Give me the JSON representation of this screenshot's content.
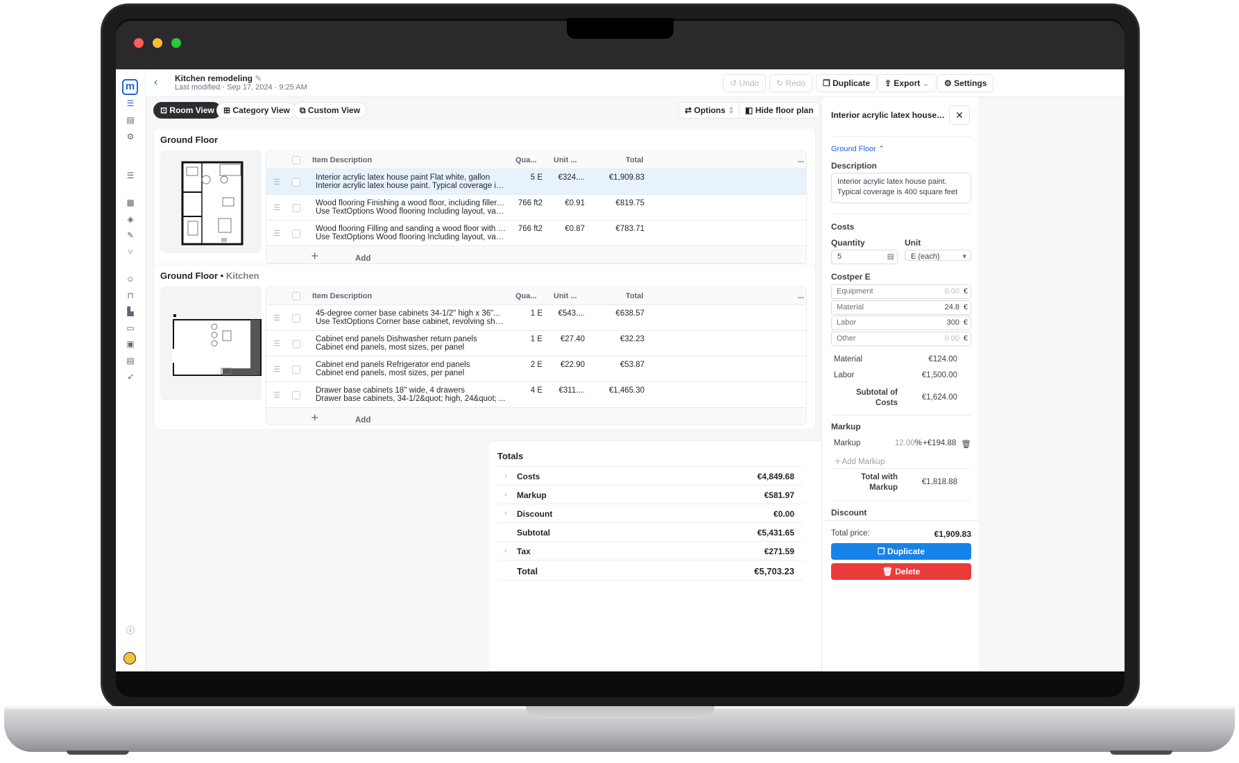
{
  "app": {
    "doc_title": "Kitchen remodeling",
    "doc_meta": "Last modified · Sep 17, 2024 · 9:25 AM",
    "logo_letter": "m"
  },
  "toolbar": {
    "undo": "Undo",
    "redo": "Redo",
    "duplicate": "Duplicate",
    "export": "Export",
    "settings": "Settings"
  },
  "views": {
    "room": "Room View",
    "category": "Category View",
    "custom": "Custom View",
    "options": "Options",
    "hide_floor_plan": "Hide floor plan"
  },
  "columns": {
    "description": "Item Description",
    "quantity": "Qua...",
    "unit": "Unit ...",
    "total": "Total",
    "more": "..."
  },
  "sections": [
    {
      "title": "Ground Floor",
      "subtitle": "",
      "add_label": "Add",
      "rows": [
        {
          "line1": "Interior acrylic latex house paint Flat white, gallon",
          "line2": "Interior acrylic latex house paint. Typical coverage is ...",
          "qty": "5 E",
          "unit": "€324....",
          "total": "€1,909.83",
          "selected": true
        },
        {
          "line1": "Wood flooring Finishing a wood floor, including filler, ...",
          "line2": "Use TextOptions Wood flooring Including layout, vap...",
          "qty": "766 ft2",
          "unit": "€0.91",
          "total": "€819.75",
          "selected": false
        },
        {
          "line1": "Wood flooring Filling and sanding a wood floor with d...",
          "line2": "Use TextOptions Wood flooring Including layout, vap...",
          "qty": "766 ft2",
          "unit": "€0.87",
          "total": "€783.71",
          "selected": false
        }
      ]
    },
    {
      "title": "Ground Floor •",
      "subtitle": "Kitchen",
      "add_label": "Add",
      "rows": [
        {
          "line1": "45-degree corner base cabinets 34-1/2\" high x 36\"...",
          "line2": "Use TextOptions Corner base cabinet, revolving shel...",
          "qty": "1 E",
          "unit": "€543....",
          "total": "€638.57",
          "selected": false
        },
        {
          "line1": "Cabinet end panels Dishwasher return panels",
          "line2": "Cabinet end panels, most sizes, per panel",
          "qty": "1 E",
          "unit": "€27.40",
          "total": "€32.23",
          "selected": false
        },
        {
          "line1": "Cabinet end panels Refrigerator end panels",
          "line2": "Cabinet end panels, most sizes, per panel",
          "qty": "2 E",
          "unit": "€22.90",
          "total": "€53.87",
          "selected": false
        },
        {
          "line1": "Drawer base cabinets 18\" wide, 4 drawers",
          "line2": "Drawer base cabinets, 34-1/2&quot; high, 24&quot; ...",
          "qty": "4 E",
          "unit": "€311....",
          "total": "€1,465.30",
          "selected": false
        }
      ]
    }
  ],
  "totals": {
    "title": "Totals",
    "rows": [
      {
        "label": "Costs",
        "value": "€4,849.68"
      },
      {
        "label": "Markup",
        "value": "€581.97"
      },
      {
        "label": "Discount",
        "value": "€0.00"
      },
      {
        "label": "Subtotal",
        "value": "€5,431.65"
      },
      {
        "label": "Tax",
        "value": "€271.59"
      },
      {
        "label": "Total",
        "value": "€5,703.23"
      }
    ]
  },
  "panel": {
    "title": "Interior acrylic latex house pa...",
    "breadcrumb": "Ground Floor",
    "description_label": "Description",
    "description": "Interior acrylic latex house paint. Typical coverage is 400 square feet",
    "costs_label": "Costs",
    "quantity_label": "Quantity",
    "quantity": "5",
    "unit_label": "Unit",
    "unit": "E (each)",
    "costper_label": "Costper E",
    "cost_inputs": [
      {
        "label": "Equipment",
        "value": "0.00",
        "currency": "€",
        "placeholder": true
      },
      {
        "label": "Material",
        "value": "24.8",
        "currency": "€",
        "placeholder": false
      },
      {
        "label": "Labor",
        "value": "300",
        "currency": "€",
        "placeholder": false
      },
      {
        "label": "Other",
        "value": "0.00",
        "currency": "€",
        "placeholder": true
      }
    ],
    "material_label": "Material",
    "material_total": "€124.00",
    "labor_label": "Labor",
    "labor_total": "€1,500.00",
    "subtotal_label_1": "Subtotal of",
    "subtotal_label_2": "Costs",
    "subtotal": "€1,624.00",
    "markup_section": "Markup",
    "markup_label": "Markup",
    "markup_pct": "12.00",
    "markup_amount": "+€194.88",
    "add_markup": "Add Markup",
    "total_markup_label_1": "Total with",
    "total_markup_label_2": "Markup",
    "total_with_markup": "€1,818.88",
    "discount_label": "Discount",
    "total_price_label": "Total price:",
    "total_price": "€1,909.83",
    "duplicate": "Duplicate",
    "delete": "Delete"
  },
  "colors": {
    "accent": "#1e63d6",
    "selected_row": "#e8f2fd",
    "duplicate_button": "#1683e8",
    "delete_button": "#ec3b3b",
    "traffic_red": "#fe5f57",
    "traffic_yellow": "#febc2e",
    "traffic_green": "#28c840"
  }
}
